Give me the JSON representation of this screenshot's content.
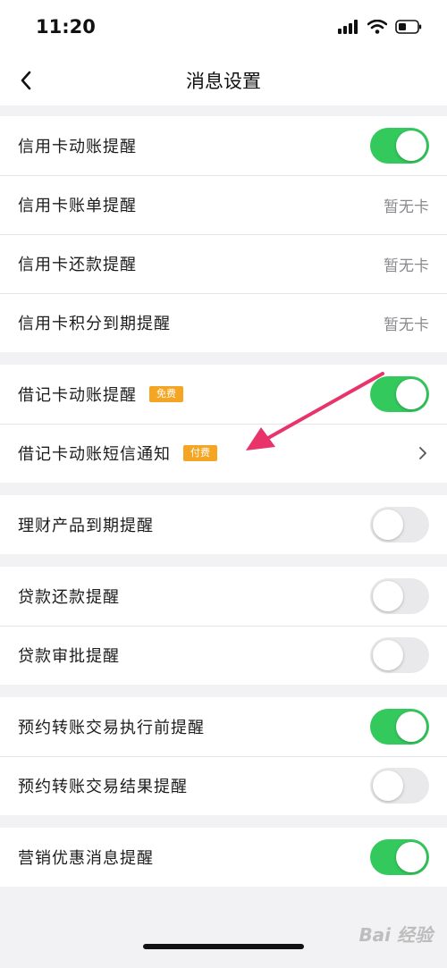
{
  "status_bar": {
    "time": "11:20"
  },
  "nav": {
    "title": "消息设置"
  },
  "colors": {
    "toggle_on": "#33c95d",
    "toggle_off": "#e9e9eb",
    "badge": "#f5a524",
    "arrow": "#e8336b"
  },
  "groups": [
    {
      "rows": [
        {
          "label": "信用卡动账提醒",
          "control": "toggle",
          "state": "on"
        },
        {
          "label": "信用卡账单提醒",
          "control": "value",
          "value": "暂无卡"
        },
        {
          "label": "信用卡还款提醒",
          "control": "value",
          "value": "暂无卡"
        },
        {
          "label": "信用卡积分到期提醒",
          "control": "value",
          "value": "暂无卡"
        }
      ]
    },
    {
      "rows": [
        {
          "label": "借记卡动账提醒",
          "badge": "免费",
          "control": "toggle",
          "state": "on"
        },
        {
          "label": "借记卡动账短信通知",
          "badge": "付费",
          "control": "chevron"
        }
      ]
    },
    {
      "rows": [
        {
          "label": "理财产品到期提醒",
          "control": "toggle",
          "state": "off"
        }
      ]
    },
    {
      "rows": [
        {
          "label": "贷款还款提醒",
          "control": "toggle",
          "state": "off"
        },
        {
          "label": "贷款审批提醒",
          "control": "toggle",
          "state": "off"
        }
      ]
    },
    {
      "rows": [
        {
          "label": "预约转账交易执行前提醒",
          "control": "toggle",
          "state": "on"
        },
        {
          "label": "预约转账交易结果提醒",
          "control": "toggle",
          "state": "off"
        }
      ]
    },
    {
      "rows": [
        {
          "label": "营销优惠消息提醒",
          "control": "toggle",
          "state": "on"
        }
      ]
    }
  ],
  "watermark": "Bai 经验"
}
